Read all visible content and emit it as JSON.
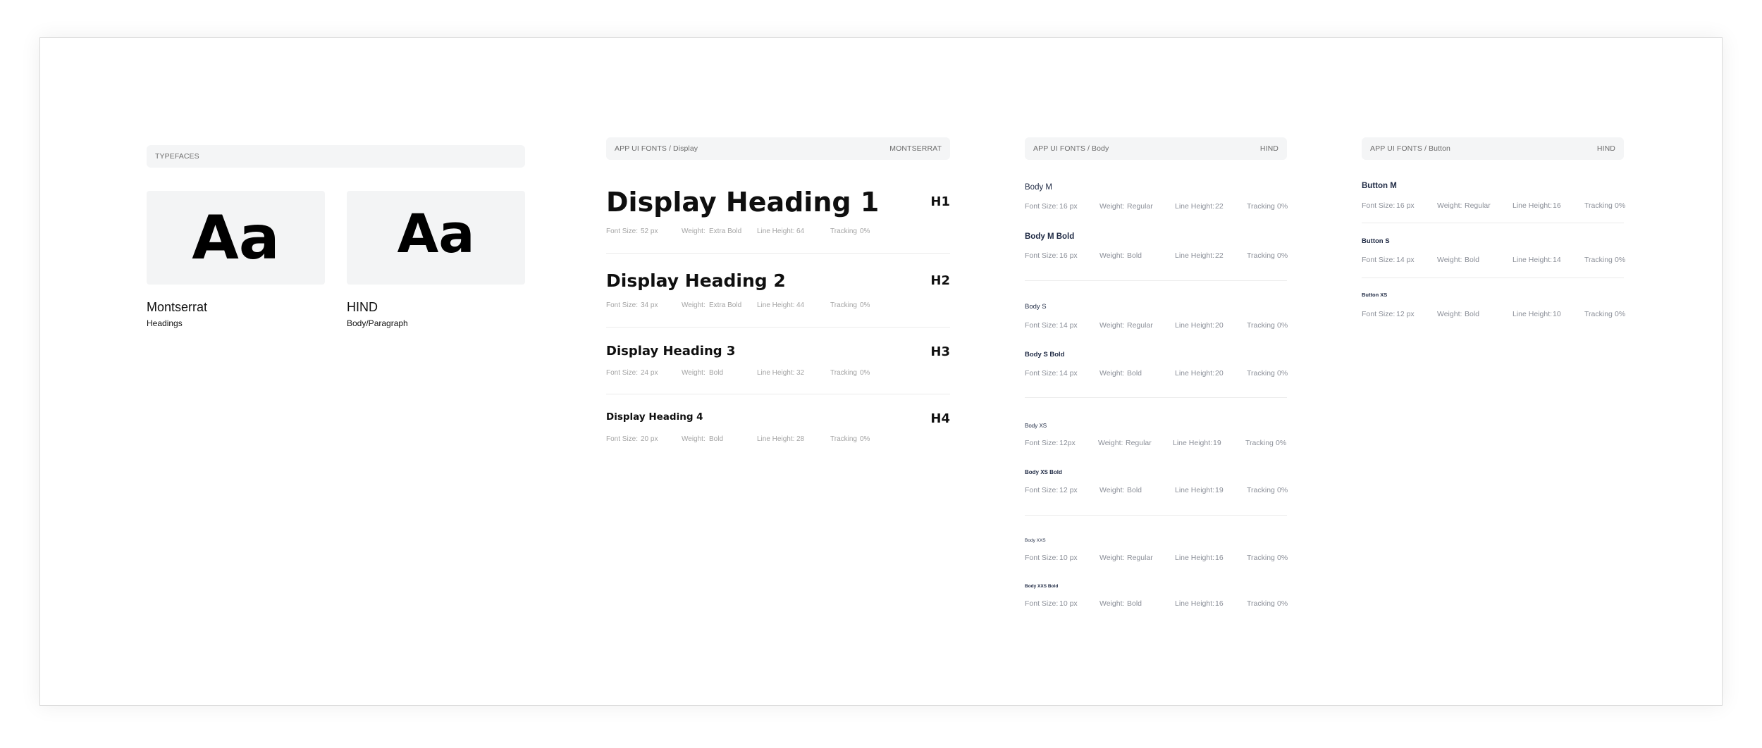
{
  "typefaces": {
    "header": "TYPEFACES",
    "items": [
      {
        "sample": "Aa",
        "name": "Montserrat",
        "role": "Headings"
      },
      {
        "sample": "Aa",
        "name": "HIND",
        "role": "Body/Paragraph"
      }
    ]
  },
  "labels": {
    "font_size": "Font Size:",
    "weight": "Weight:",
    "line_height": "Line Height:",
    "tracking": "Tracking"
  },
  "display": {
    "header_left": "APP UI FONTS / Display",
    "header_right": "MONTSERRAT",
    "rows": [
      {
        "name": "Display Heading 1",
        "tag": "H1",
        "font_size": "52 px",
        "weight": "Extra Bold",
        "line_height": "64",
        "tracking": "0%"
      },
      {
        "name": "Display Heading 2",
        "tag": "H2",
        "font_size": "34 px",
        "weight": "Extra Bold",
        "line_height": "44",
        "tracking": "0%"
      },
      {
        "name": "Display Heading 3",
        "tag": "H3",
        "font_size": "24 px",
        "weight": "Bold",
        "line_height": "32",
        "tracking": "0%"
      },
      {
        "name": "Display Heading 4",
        "tag": "H4",
        "font_size": "20 px",
        "weight": "Bold",
        "line_height": "28",
        "tracking": "0%"
      }
    ]
  },
  "body": {
    "header_left": "APP UI FONTS / Body",
    "header_right": "HIND",
    "rows": [
      {
        "name": "Body M",
        "font_size": "16 px",
        "weight": "Regular",
        "line_height": "22",
        "tracking": "0%"
      },
      {
        "name": "Body M Bold",
        "font_size": "16 px",
        "weight": "Bold",
        "line_height": "22",
        "tracking": "0%"
      },
      {
        "name": "Body S",
        "font_size": "14 px",
        "weight": "Regular",
        "line_height": "20",
        "tracking": "0%"
      },
      {
        "name": "Body S Bold",
        "font_size": "14 px",
        "weight": "Bold",
        "line_height": "20",
        "tracking": "0%"
      },
      {
        "name": "Body XS",
        "font_size": "12px",
        "weight": "Regular",
        "line_height": "19",
        "tracking": "0%"
      },
      {
        "name": "Body XS Bold",
        "font_size": "12 px",
        "weight": "Bold",
        "line_height": "19",
        "tracking": "0%"
      },
      {
        "name": "Body XXS",
        "font_size": "10 px",
        "weight": "Regular",
        "line_height": "16",
        "tracking": "0%"
      },
      {
        "name": "Body XXS Bold",
        "font_size": "10 px",
        "weight": "Bold",
        "line_height": "16",
        "tracking": "0%"
      }
    ]
  },
  "button": {
    "header_left": "APP UI FONTS / Button",
    "header_right": "HIND",
    "rows": [
      {
        "name": "Button M",
        "font_size": "16 px",
        "weight": "Regular",
        "line_height": "16",
        "tracking": "0%"
      },
      {
        "name": "Button S",
        "font_size": "14 px",
        "weight": "Bold",
        "line_height": "14",
        "tracking": "0%"
      },
      {
        "name": "Button XS",
        "font_size": "12 px",
        "weight": "Bold",
        "line_height": "10",
        "tracking": "0%"
      }
    ]
  }
}
